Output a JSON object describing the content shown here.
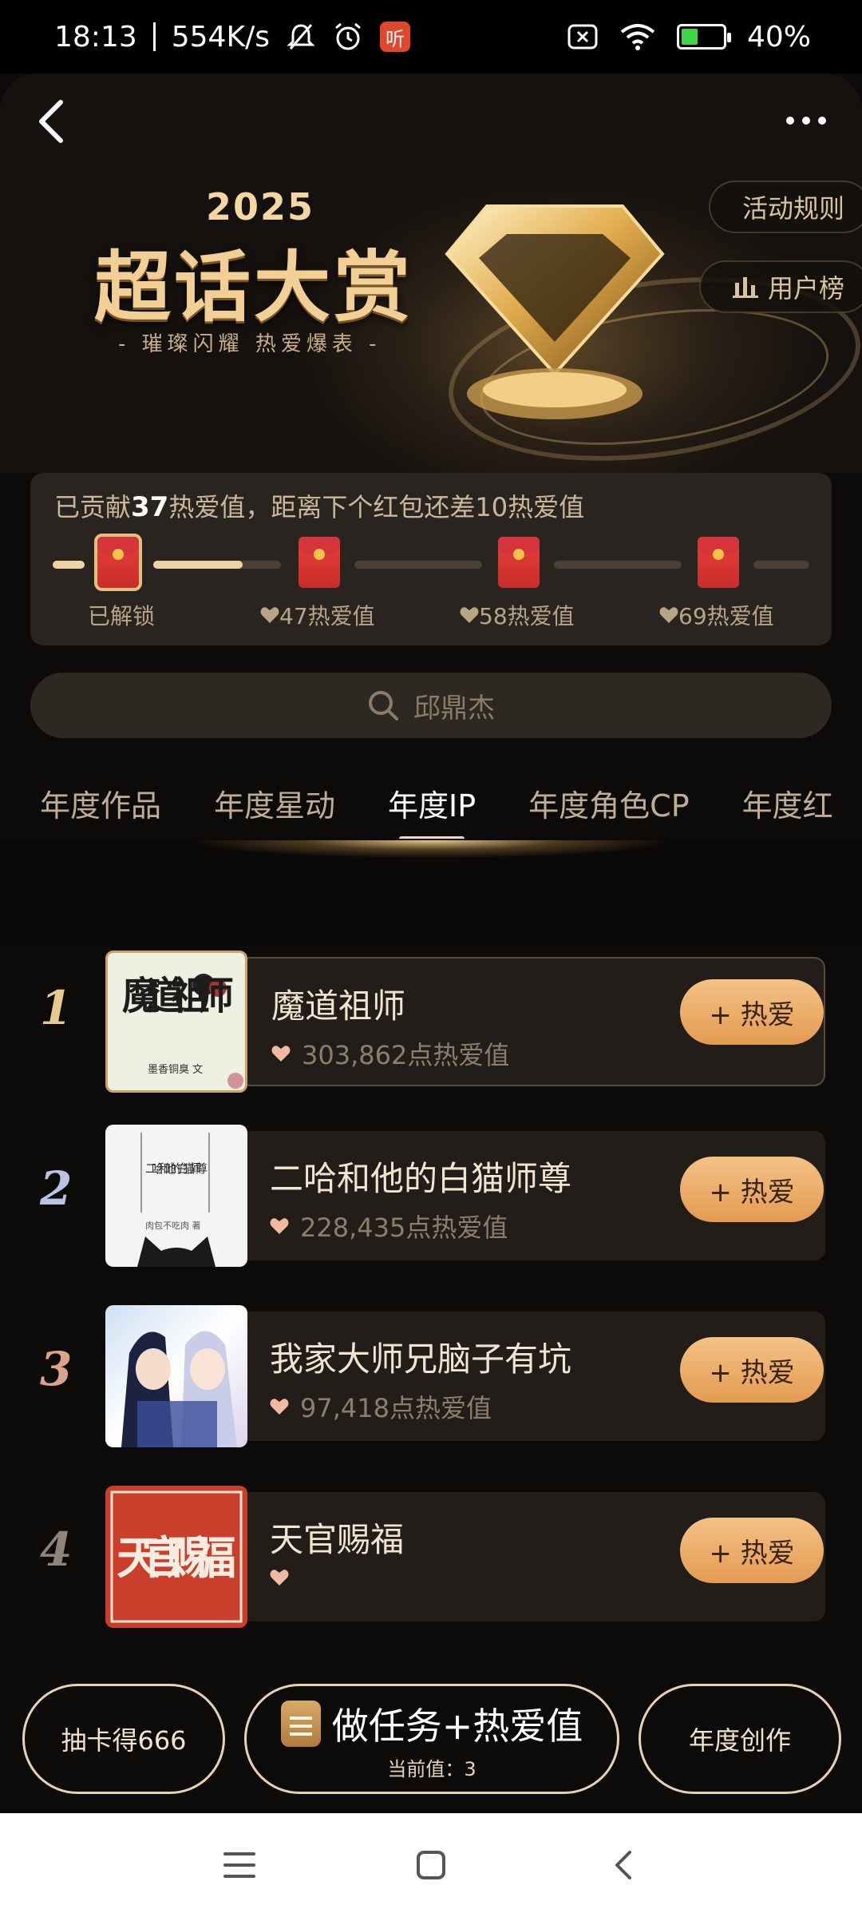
{
  "status_bar": {
    "time": "18:13",
    "net_speed": "554K/s",
    "app_badge": "听",
    "battery": "40%",
    "battery_level": 0.4,
    "icons": [
      "mute-icon",
      "alarm-icon",
      "sim-off-icon",
      "wifi-icon",
      "battery-charging-icon"
    ]
  },
  "banner": {
    "year": "2025",
    "title": "超话大赏",
    "subtitle": "- 璀璨闪耀 热爱爆表 -",
    "rules_label": "活动规则",
    "rank_label": "用户榜"
  },
  "progress": {
    "prefix": "已贡献",
    "contributed": "37",
    "suffix": "热爱值，距离下个红包还差10热爱值",
    "milestones": [
      {
        "label": "已解锁",
        "unlocked": true
      },
      {
        "label": "47热爱值",
        "unlocked": false
      },
      {
        "label": "58热爱值",
        "unlocked": false
      },
      {
        "label": "69热爱值",
        "unlocked": false
      }
    ],
    "segment_fill": [
      1.0,
      0.7,
      0.0,
      0.0,
      0.0
    ]
  },
  "search": {
    "placeholder": "邱鼎杰"
  },
  "tabs": [
    {
      "label": "年度作品",
      "active": false
    },
    {
      "label": "年度星动",
      "active": false
    },
    {
      "label": "年度IP",
      "active": true
    },
    {
      "label": "年度角色CP",
      "active": false
    },
    {
      "label": "年度红",
      "active": false
    }
  ],
  "list": [
    {
      "rank": "1",
      "title": "魔道祖师",
      "score": "303,862点热爱值",
      "button": "+ 热爱",
      "rank_color": "#e8c990"
    },
    {
      "rank": "2",
      "title": "二哈和他的白猫师尊",
      "score": "228,435点热爱值",
      "button": "+ 热爱",
      "rank_color": "#b9c4e4"
    },
    {
      "rank": "3",
      "title": "我家大师兄脑子有坑",
      "score": "97,418点热爱值",
      "button": "+ 热爱",
      "rank_color": "#d9a58a"
    },
    {
      "rank": "4",
      "title": "天官赐福",
      "score": "",
      "button": "+ 热爱",
      "rank_color": "#8e8478"
    }
  ],
  "covers": {
    "cover1_text": "魔道祖师",
    "cover1_author": "墨香铜臭 文",
    "cover2_text": "二哈和他的白猫师尊",
    "cover2_author": "肉包不吃肉 著",
    "cover4_text": "天官赐福"
  },
  "actions": {
    "left": "抽卡得666",
    "mid_title": "做任务+热爱值",
    "mid_sub": "当前值：3",
    "right": "年度创作"
  },
  "colors": {
    "accent_gold": "#f0d9b3",
    "button_orange": "#e49b52",
    "background": "#0d0b0a"
  }
}
